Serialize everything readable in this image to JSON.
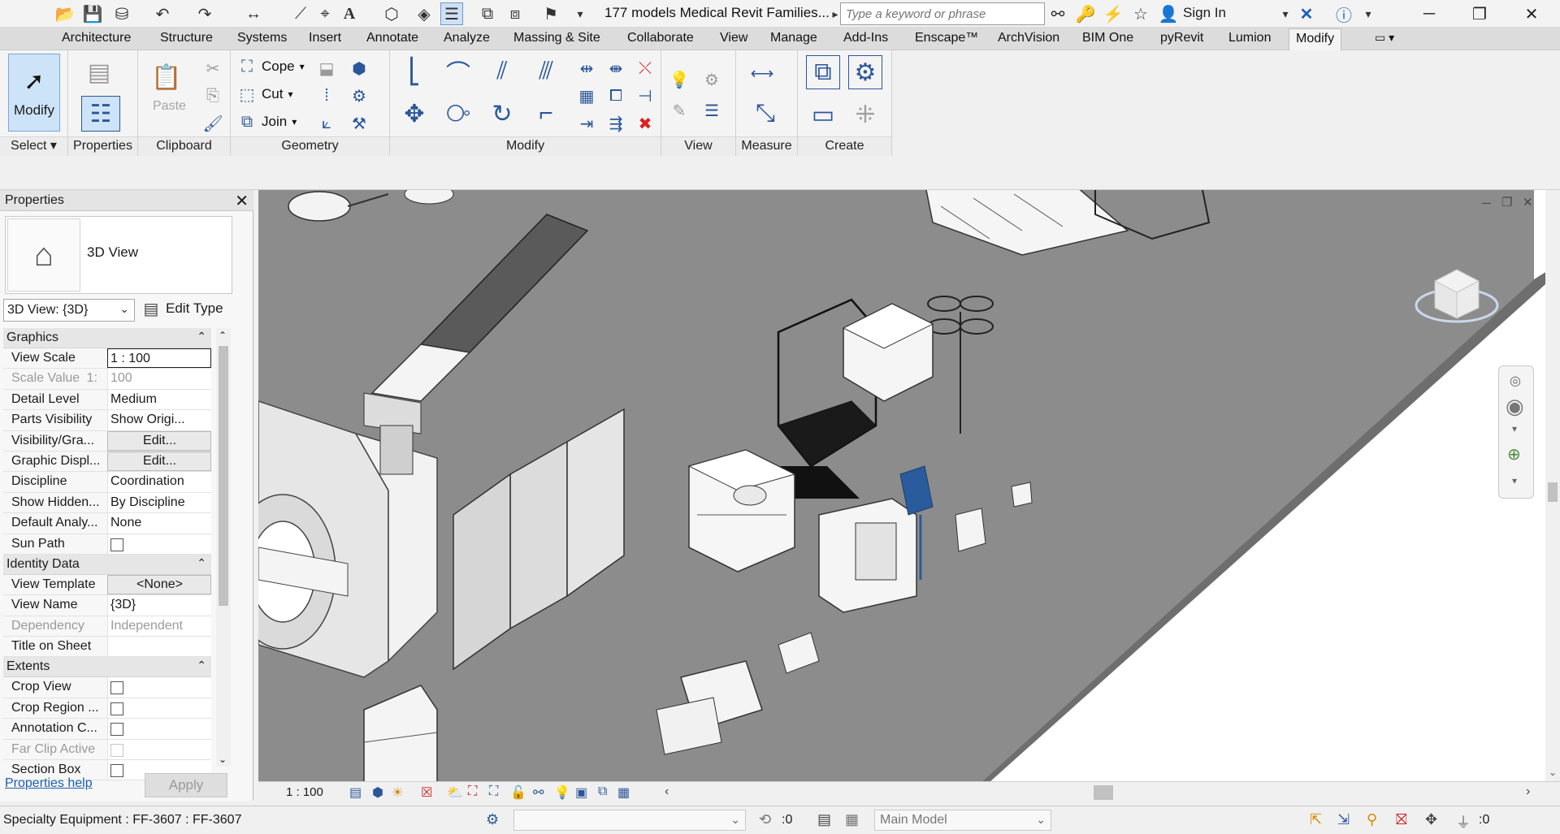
{
  "window": {
    "title": "177 models Medical Revit Families...",
    "search_placeholder": "Type a keyword or phrase",
    "sign_in": "Sign In"
  },
  "ribbon": {
    "tabs": [
      "Architecture",
      "Structure",
      "Systems",
      "Insert",
      "Annotate",
      "Analyze",
      "Massing & Site",
      "Collaborate",
      "View",
      "Manage",
      "Add-Ins",
      "Enscape™",
      "ArchVision",
      "BIM One",
      "pyRevit",
      "Lumion",
      "Modify"
    ],
    "active_tab": "Modify",
    "modify_label": "Modify",
    "geometry": {
      "cope": "Cope",
      "cut": "Cut",
      "join": "Join"
    },
    "clipboard": {
      "paste": "Paste"
    },
    "panels": {
      "select": "Select",
      "properties": "Properties",
      "clipboard": "Clipboard",
      "geometry": "Geometry",
      "modify": "Modify",
      "view": "View",
      "measure": "Measure",
      "create": "Create"
    }
  },
  "properties": {
    "title": "Properties",
    "type_name": "3D View",
    "view_selector": "3D View: {3D}",
    "edit_type": "Edit Type",
    "sections": {
      "graphics": "Graphics",
      "identity": "Identity Data",
      "extents": "Extents"
    },
    "rows": {
      "view_scale": {
        "name": "View Scale",
        "value": "1 : 100"
      },
      "scale_value": {
        "name": "Scale Value",
        "prefix": "1:",
        "value": "100"
      },
      "detail_level": {
        "name": "Detail Level",
        "value": "Medium"
      },
      "parts_visibility": {
        "name": "Parts Visibility",
        "value": "Show Origi..."
      },
      "visibility_graphics": {
        "name": "Visibility/Gra...",
        "value": "Edit..."
      },
      "graphic_display": {
        "name": "Graphic Displ...",
        "value": "Edit..."
      },
      "discipline": {
        "name": "Discipline",
        "value": "Coordination"
      },
      "show_hidden": {
        "name": "Show Hidden...",
        "value": "By Discipline"
      },
      "default_analysis": {
        "name": "Default Analy...",
        "value": "None"
      },
      "sun_path": {
        "name": "Sun Path"
      },
      "view_template": {
        "name": "View Template",
        "value": "<None>"
      },
      "view_name": {
        "name": "View Name",
        "value": "{3D}"
      },
      "dependency": {
        "name": "Dependency",
        "value": "Independent"
      },
      "title_on_sheet": {
        "name": "Title on Sheet",
        "value": ""
      },
      "crop_view": {
        "name": "Crop View"
      },
      "crop_region": {
        "name": "Crop Region ..."
      },
      "annotation_crop": {
        "name": "Annotation C..."
      },
      "far_clip": {
        "name": "Far Clip Active"
      },
      "section_box": {
        "name": "Section Box"
      }
    },
    "help_link": "Properties help",
    "apply": "Apply"
  },
  "view_control": {
    "scale": "1 : 100"
  },
  "status": {
    "text": "Specialty Equipment : FF-3607 : FF-3607",
    "selection_count": ":0",
    "model": "Main Model",
    "filter_count": ":0"
  },
  "colors": {
    "accent": "#2b579a",
    "floor": "#8c8c8c",
    "active_tab_bg": "#f4f4f4"
  }
}
